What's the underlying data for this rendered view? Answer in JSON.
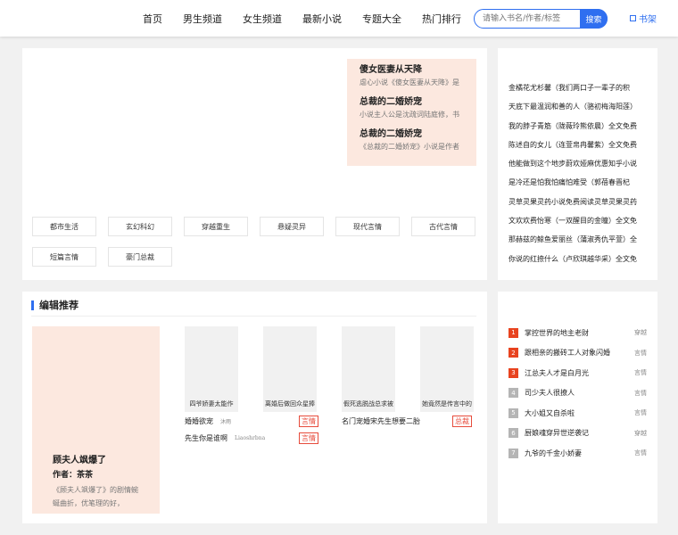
{
  "nav": {
    "items": [
      "首页",
      "男生频道",
      "女生频道",
      "最新小说",
      "专题大全",
      "热门排行"
    ],
    "search_placeholder": "请输入书名/作者/标签",
    "search_button": "搜索",
    "shelf": "书架"
  },
  "featured": [
    {
      "title": "傻女医妻从天降",
      "desc": "虐心小说《傻女医妻从天降》是"
    },
    {
      "title": "总裁的二婚娇宠",
      "desc": "小说主人公是沈疏词陆庭修，书"
    },
    {
      "title": "总裁的二婚娇宠",
      "desc": "《总裁的二婚娇宠》小说是作者"
    }
  ],
  "categories": [
    "都市生活",
    "玄幻科幻",
    "穿越重生",
    "悬疑灵异",
    "现代言情",
    "古代言情",
    "短篇言情",
    "豪门总裁"
  ],
  "side_list": [
    "金橘花尤杉馨（我们两口子一辈子的积",
    "天底下最温润和善的人（骆初梅海阳莲）",
    "我的脖子青筋（陇薇玲熊依晨）全文免费",
    "陈述自的女儿（连萱帛冉馨紫）全文免费",
    "他能做到这个地步蔚欢娅麻优惠知乎小说",
    "是冷还是怕我怕痛怕难受（郭蓓春晋杞",
    "灵草灵果灵药小说免费阅读灵草灵果灵药",
    "文欢欢费怡寒（一双醒目的金瞳）全文免",
    "那赫兹的鲸鱼爱丽丝（蒲淑秀仇平萱）全",
    "你说的红捺什么（卢欣琪越华采）全文免"
  ],
  "editor": {
    "heading": "编辑推荐",
    "main": {
      "title": "顾夫人飒爆了",
      "author": "作者：茶茶",
      "desc": "《顾夫人飒爆了》的剧情蜿蜒曲折，优笔理的好，"
    },
    "covers": [
      "四爷娇妻太能作",
      "离婚后做回众星捧",
      "假死逃脱战总求被",
      "她竟然是传言中的"
    ],
    "books": [
      {
        "name": "婚婚欲宠",
        "author": "沐雨",
        "tag": "言情"
      },
      {
        "name": "先生你是谁啊",
        "author": "Liaoshrbna",
        "tag": "言情"
      },
      {
        "name": "名门宠婚宋先生想要二胎",
        "author": "",
        "tag": "总裁"
      }
    ]
  },
  "rank": [
    {
      "no": "1",
      "name": "掌控世界的地主老财",
      "type": "穿越"
    },
    {
      "no": "2",
      "name": "跟相亲的搬砖工人对象闪婚",
      "type": "言情"
    },
    {
      "no": "3",
      "name": "江总夫人才是白月光",
      "type": "言情"
    },
    {
      "no": "4",
      "name": "司少夫人很撩人",
      "type": "言情"
    },
    {
      "no": "5",
      "name": "大小姐又自杀啦",
      "type": "言情"
    },
    {
      "no": "6",
      "name": "厨娘魂穿异世逆袭记",
      "type": "穿越"
    },
    {
      "no": "7",
      "name": "九爷的千金小娇妻",
      "type": "言情"
    }
  ],
  "colors": {
    "accent": "#2f6ff0",
    "hot": "#e8431f",
    "pink": "#fce8df"
  }
}
